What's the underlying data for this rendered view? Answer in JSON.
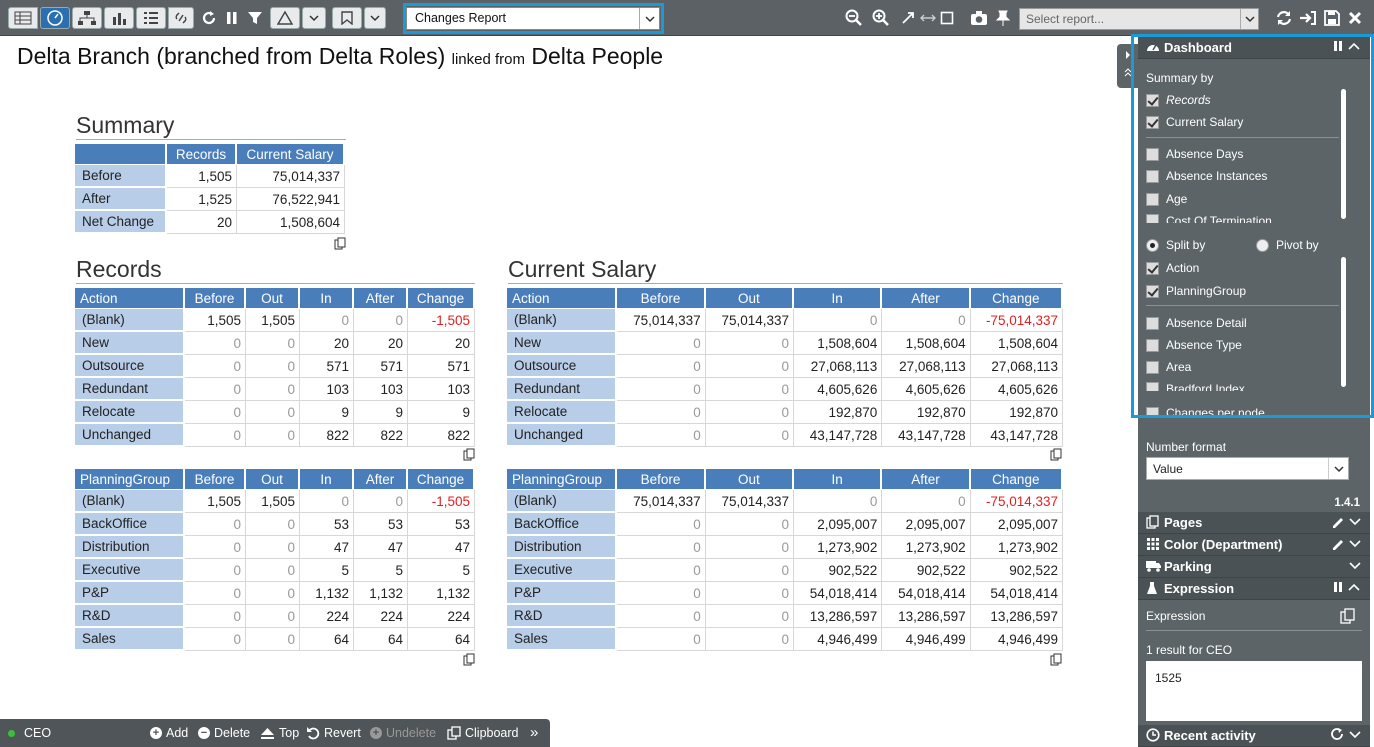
{
  "toolbar": {
    "report_name": "Changes Report",
    "select_report_placeholder": "Select report..."
  },
  "title": {
    "main": "Delta Branch (branched from Delta Roles)",
    "linked": "linked from",
    "source": "Delta People"
  },
  "summary": {
    "heading": "Summary",
    "headers": [
      "",
      "Records",
      "Current Salary"
    ],
    "rows": [
      [
        "Before",
        "1,505",
        "75,014,337"
      ],
      [
        "After",
        "1,525",
        "76,522,941"
      ],
      [
        "Net Change",
        "20",
        "1,508,604"
      ]
    ]
  },
  "records_heading": "Records",
  "salary_heading": "Current Salary",
  "records_action": {
    "headers": [
      "Action",
      "Before",
      "Out",
      "In",
      "After",
      "Change"
    ],
    "rows": [
      [
        "(Blank)",
        "1,505",
        "1,505",
        "0",
        "0",
        "-1,505"
      ],
      [
        "New",
        "0",
        "0",
        "20",
        "20",
        "20"
      ],
      [
        "Outsource",
        "0",
        "0",
        "571",
        "571",
        "571"
      ],
      [
        "Redundant",
        "0",
        "0",
        "103",
        "103",
        "103"
      ],
      [
        "Relocate",
        "0",
        "0",
        "9",
        "9",
        "9"
      ],
      [
        "Unchanged",
        "0",
        "0",
        "822",
        "822",
        "822"
      ]
    ]
  },
  "salary_action": {
    "headers": [
      "Action",
      "Before",
      "Out",
      "In",
      "After",
      "Change"
    ],
    "rows": [
      [
        "(Blank)",
        "75,014,337",
        "75,014,337",
        "0",
        "0",
        "-75,014,337"
      ],
      [
        "New",
        "0",
        "0",
        "1,508,604",
        "1,508,604",
        "1,508,604"
      ],
      [
        "Outsource",
        "0",
        "0",
        "27,068,113",
        "27,068,113",
        "27,068,113"
      ],
      [
        "Redundant",
        "0",
        "0",
        "4,605,626",
        "4,605,626",
        "4,605,626"
      ],
      [
        "Relocate",
        "0",
        "0",
        "192,870",
        "192,870",
        "192,870"
      ],
      [
        "Unchanged",
        "0",
        "0",
        "43,147,728",
        "43,147,728",
        "43,147,728"
      ]
    ]
  },
  "records_pg": {
    "headers": [
      "PlanningGroup",
      "Before",
      "Out",
      "In",
      "After",
      "Change"
    ],
    "rows": [
      [
        "(Blank)",
        "1,505",
        "1,505",
        "0",
        "0",
        "-1,505"
      ],
      [
        "BackOffice",
        "0",
        "0",
        "53",
        "53",
        "53"
      ],
      [
        "Distribution",
        "0",
        "0",
        "47",
        "47",
        "47"
      ],
      [
        "Executive",
        "0",
        "0",
        "5",
        "5",
        "5"
      ],
      [
        "P&P",
        "0",
        "0",
        "1,132",
        "1,132",
        "1,132"
      ],
      [
        "R&D",
        "0",
        "0",
        "224",
        "224",
        "224"
      ],
      [
        "Sales",
        "0",
        "0",
        "64",
        "64",
        "64"
      ]
    ]
  },
  "salary_pg": {
    "headers": [
      "PlanningGroup",
      "Before",
      "Out",
      "In",
      "After",
      "Change"
    ],
    "rows": [
      [
        "(Blank)",
        "75,014,337",
        "75,014,337",
        "0",
        "0",
        "-75,014,337"
      ],
      [
        "BackOffice",
        "0",
        "0",
        "2,095,007",
        "2,095,007",
        "2,095,007"
      ],
      [
        "Distribution",
        "0",
        "0",
        "1,273,902",
        "1,273,902",
        "1,273,902"
      ],
      [
        "Executive",
        "0",
        "0",
        "902,522",
        "902,522",
        "902,522"
      ],
      [
        "P&P",
        "0",
        "0",
        "54,018,414",
        "54,018,414",
        "54,018,414"
      ],
      [
        "R&D",
        "0",
        "0",
        "13,286,597",
        "13,286,597",
        "13,286,597"
      ],
      [
        "Sales",
        "0",
        "0",
        "4,946,499",
        "4,946,499",
        "4,946,499"
      ]
    ]
  },
  "panel": {
    "dashboard": "Dashboard",
    "summary_by": "Summary by",
    "summary_items": [
      {
        "label": "Records",
        "checked": true,
        "italic": true
      },
      {
        "label": "Current Salary",
        "checked": true
      },
      {
        "label": "Absence Days",
        "checked": false
      },
      {
        "label": "Absence Instances",
        "checked": false
      },
      {
        "label": "Age",
        "checked": false
      },
      {
        "label": "Cost Of Termination",
        "checked": false
      }
    ],
    "split_by": "Split by",
    "pivot_by": "Pivot by",
    "split_items": [
      {
        "label": "Action",
        "checked": true
      },
      {
        "label": "PlanningGroup",
        "checked": true
      },
      {
        "label": "Absence Detail",
        "checked": false
      },
      {
        "label": "Absence Type",
        "checked": false
      },
      {
        "label": "Area",
        "checked": false
      },
      {
        "label": "Bradford Index",
        "checked": false
      }
    ],
    "changes_per_node": "Changes per node",
    "number_format_label": "Number format",
    "number_format_value": "Value",
    "version": "1.4.1",
    "pages": "Pages",
    "color": "Color (Department)",
    "parking": "Parking",
    "expression": "Expression",
    "expression_label": "Expression",
    "result_label": "1 result for CEO",
    "result_value": "1525",
    "recent_activity": "Recent activity"
  },
  "bottombar": {
    "node": "CEO",
    "add": "Add",
    "delete": "Delete",
    "top": "Top",
    "revert": "Revert",
    "undelete": "Undelete",
    "clipboard": "Clipboard",
    "more": "»"
  }
}
